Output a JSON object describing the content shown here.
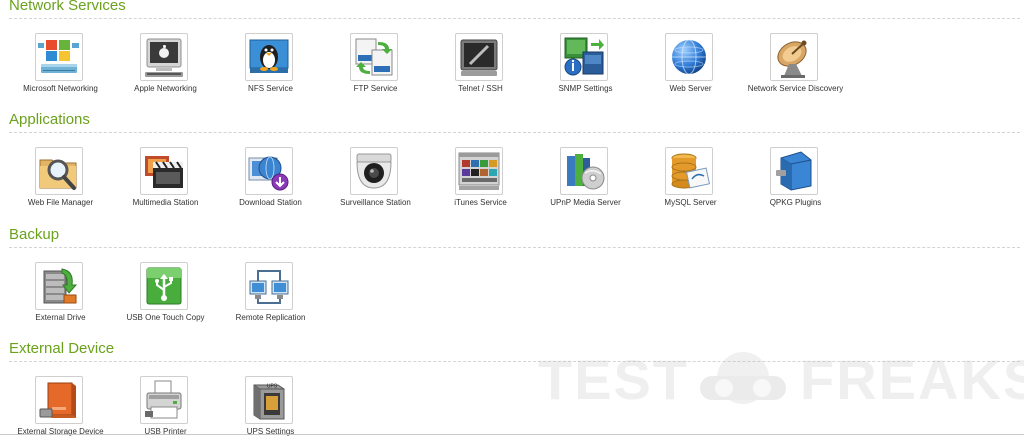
{
  "sections": [
    {
      "title": "Network Services",
      "items": [
        {
          "label": "Microsoft Networking",
          "icon": "windows-network-icon"
        },
        {
          "label": "Apple Networking",
          "icon": "apple-monitor-icon"
        },
        {
          "label": "NFS Service",
          "icon": "linux-penguin-icon"
        },
        {
          "label": "FTP Service",
          "icon": "ftp-transfer-icon"
        },
        {
          "label": "Telnet / SSH",
          "icon": "terminal-icon"
        },
        {
          "label": "SNMP Settings",
          "icon": "snmp-monitor-icon"
        },
        {
          "label": "Web Server",
          "icon": "globe-icon"
        },
        {
          "label": "Network Service Discovery",
          "icon": "satellite-dish-icon"
        }
      ]
    },
    {
      "title": "Applications",
      "items": [
        {
          "label": "Web File Manager",
          "icon": "folder-magnifier-icon"
        },
        {
          "label": "Multimedia Station",
          "icon": "clapperboard-icon"
        },
        {
          "label": "Download Station",
          "icon": "download-globe-icon"
        },
        {
          "label": "Surveillance Station",
          "icon": "security-camera-icon"
        },
        {
          "label": "iTunes Service",
          "icon": "itunes-grid-icon"
        },
        {
          "label": "UPnP Media Server",
          "icon": "media-disc-icon"
        },
        {
          "label": "MySQL Server",
          "icon": "database-icon"
        },
        {
          "label": "QPKG Plugins",
          "icon": "qpkg-box-icon"
        }
      ]
    },
    {
      "title": "Backup",
      "items": [
        {
          "label": "External Drive",
          "icon": "server-arrow-icon"
        },
        {
          "label": "USB One Touch Copy",
          "icon": "usb-icon"
        },
        {
          "label": "Remote Replication",
          "icon": "replication-icon"
        }
      ]
    },
    {
      "title": "External Device",
      "items": [
        {
          "label": "External Storage Device",
          "icon": "external-drive-icon"
        },
        {
          "label": "USB Printer",
          "icon": "printer-icon"
        },
        {
          "label": "UPS Settings",
          "icon": "ups-icon"
        }
      ]
    }
  ],
  "watermark": {
    "left": "TEST",
    "right": "FREAKS"
  },
  "colors": {
    "heading": "#6ba21d",
    "label": "#333333",
    "tile_border": "#cfcfcf"
  }
}
